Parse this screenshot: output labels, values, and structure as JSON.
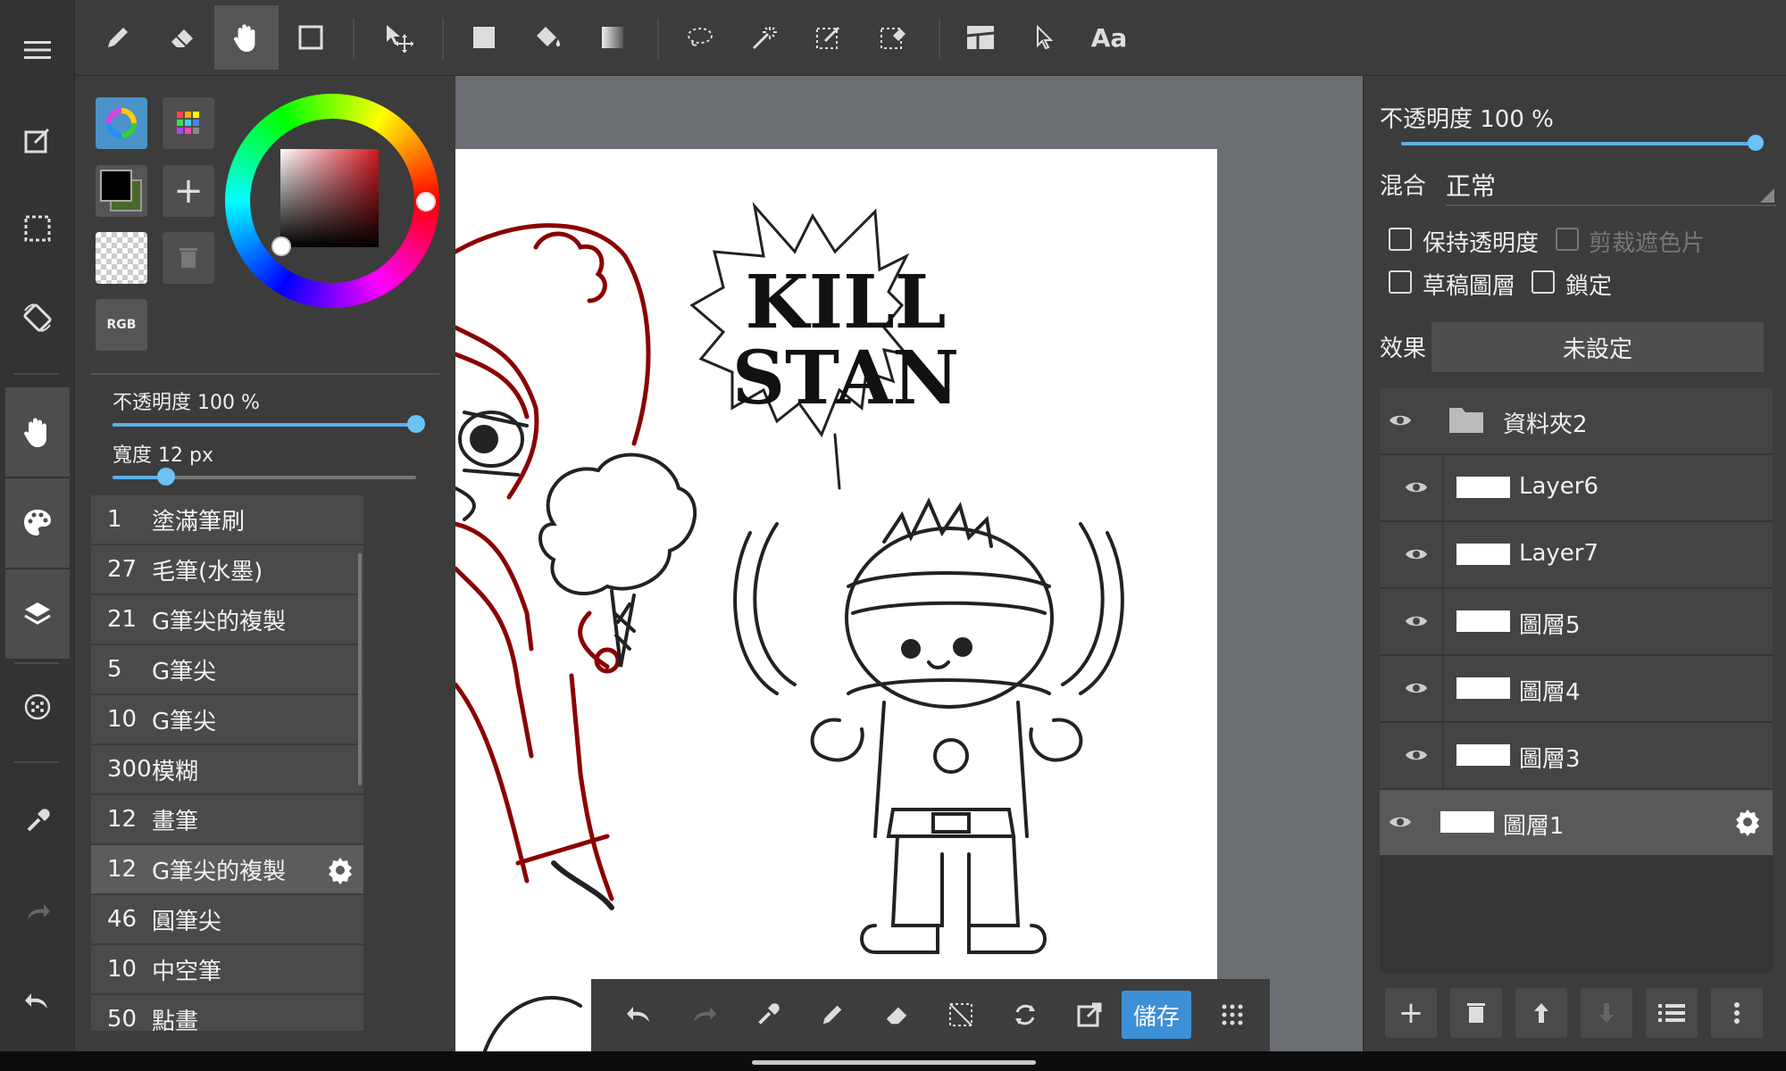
{
  "left_panel": {
    "rgb_label": "RGB",
    "brush_opacity_label": "不透明度 100 %",
    "brush_opacity_value": 1.0,
    "brush_width_label": "寬度 12 px",
    "brush_width_value": 0.16,
    "brushes": [
      {
        "num": "1",
        "name": "塗滿筆刷"
      },
      {
        "num": "27",
        "name": "毛筆(水墨)"
      },
      {
        "num": "21",
        "name": "G筆尖的複製"
      },
      {
        "num": "5",
        "name": "G筆尖"
      },
      {
        "num": "10",
        "name": "G筆尖"
      },
      {
        "num": "300",
        "name": "模糊"
      },
      {
        "num": "12",
        "name": "畫筆"
      },
      {
        "num": "12",
        "name": "G筆尖的複製"
      },
      {
        "num": "46",
        "name": "圓筆尖"
      },
      {
        "num": "10",
        "name": "中空筆"
      },
      {
        "num": "50",
        "name": "點畫"
      }
    ],
    "selected_brush_index": 7
  },
  "canvas": {
    "speech_line1": "KILL",
    "speech_line2": "STAN"
  },
  "bottom_bar": {
    "save_label": "儲存"
  },
  "right_panel": {
    "opacity_label": "不透明度 100 %",
    "opacity_value": 1.0,
    "blend_label": "混合",
    "blend_value": "正常",
    "keep_alpha_label": "保持透明度",
    "clip_label": "剪裁遮色片",
    "draft_label": "草稿圖層",
    "lock_label": "鎖定",
    "effect_label": "效果",
    "effect_value": "未設定",
    "layers": [
      {
        "name": "資料夾2",
        "type": "folder"
      },
      {
        "name": "Layer6",
        "type": "layer"
      },
      {
        "name": "Layer7",
        "type": "layer"
      },
      {
        "name": "圖層5",
        "type": "layer"
      },
      {
        "name": "圖層4",
        "type": "layer"
      },
      {
        "name": "圖層3",
        "type": "layer"
      },
      {
        "name": "圖層1",
        "type": "layer"
      }
    ],
    "selected_layer_index": 6
  },
  "colors": {
    "accent": "#5cb0ea",
    "save_button": "#3d8fd6",
    "foreground": "#000000",
    "background": "#4a6a2a",
    "sketch_red": "#8b0000"
  }
}
